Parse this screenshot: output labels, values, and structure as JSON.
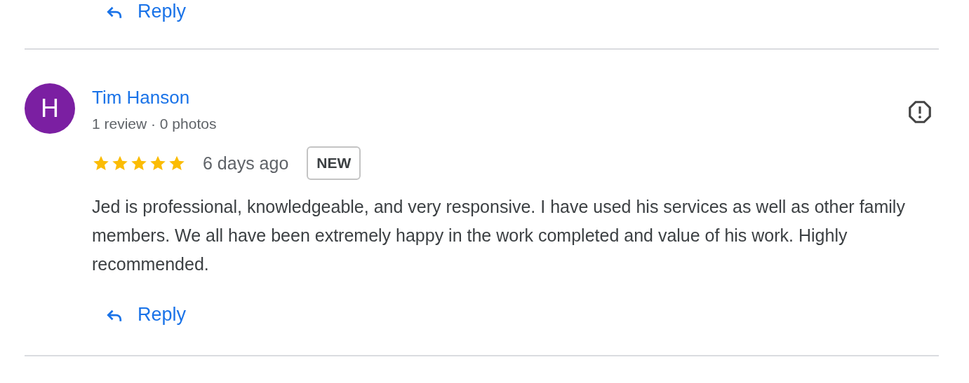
{
  "previous_review": {
    "reply_label": "Reply"
  },
  "review": {
    "avatar_letter": "H",
    "name": "Tim Hanson",
    "meta": "1 review · 0 photos",
    "stars": 5,
    "time": "6 days ago",
    "badge": "NEW",
    "text": "Jed is professional, knowledgeable, and very responsive. I have used his services as well as other family members. We all have been extremely happy in the work completed and value of his work. Highly recommended.",
    "reply_label": "Reply"
  }
}
